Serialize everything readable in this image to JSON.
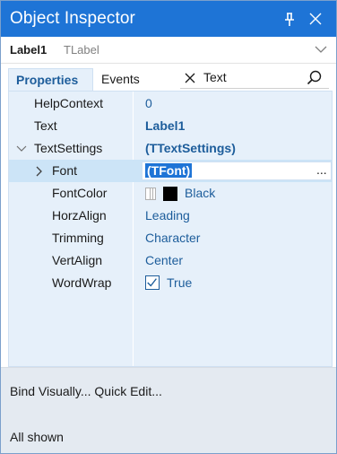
{
  "window": {
    "title": "Object Inspector"
  },
  "component": {
    "name": "Label1",
    "type": "TLabel"
  },
  "tabs": [
    {
      "label": "Properties"
    },
    {
      "label": "Events"
    }
  ],
  "search": {
    "value": "Text"
  },
  "properties": [
    {
      "name": "HelpContext",
      "value": "0"
    },
    {
      "name": "Text",
      "value": "Label1"
    },
    {
      "name": "TextSettings",
      "value": "(TTextSettings)"
    },
    {
      "name": "Font",
      "value": "(TFont)",
      "ellipsis": "..."
    },
    {
      "name": "FontColor",
      "value": "Black"
    },
    {
      "name": "HorzAlign",
      "value": "Leading"
    },
    {
      "name": "Trimming",
      "value": "Character"
    },
    {
      "name": "VertAlign",
      "value": "Center"
    },
    {
      "name": "WordWrap",
      "value": "True",
      "checked": true
    }
  ],
  "footer": {
    "bind_visually": "Bind Visually...",
    "quick_edit": "Quick Edit...",
    "status": "All shown"
  },
  "colors": {
    "titlebar": "#1e74d6",
    "accent_text": "#1d5d9b",
    "grid_bg": "#e6f0fa",
    "selected_row": "#cce4f7",
    "footer_bg": "#e4eaf1"
  }
}
